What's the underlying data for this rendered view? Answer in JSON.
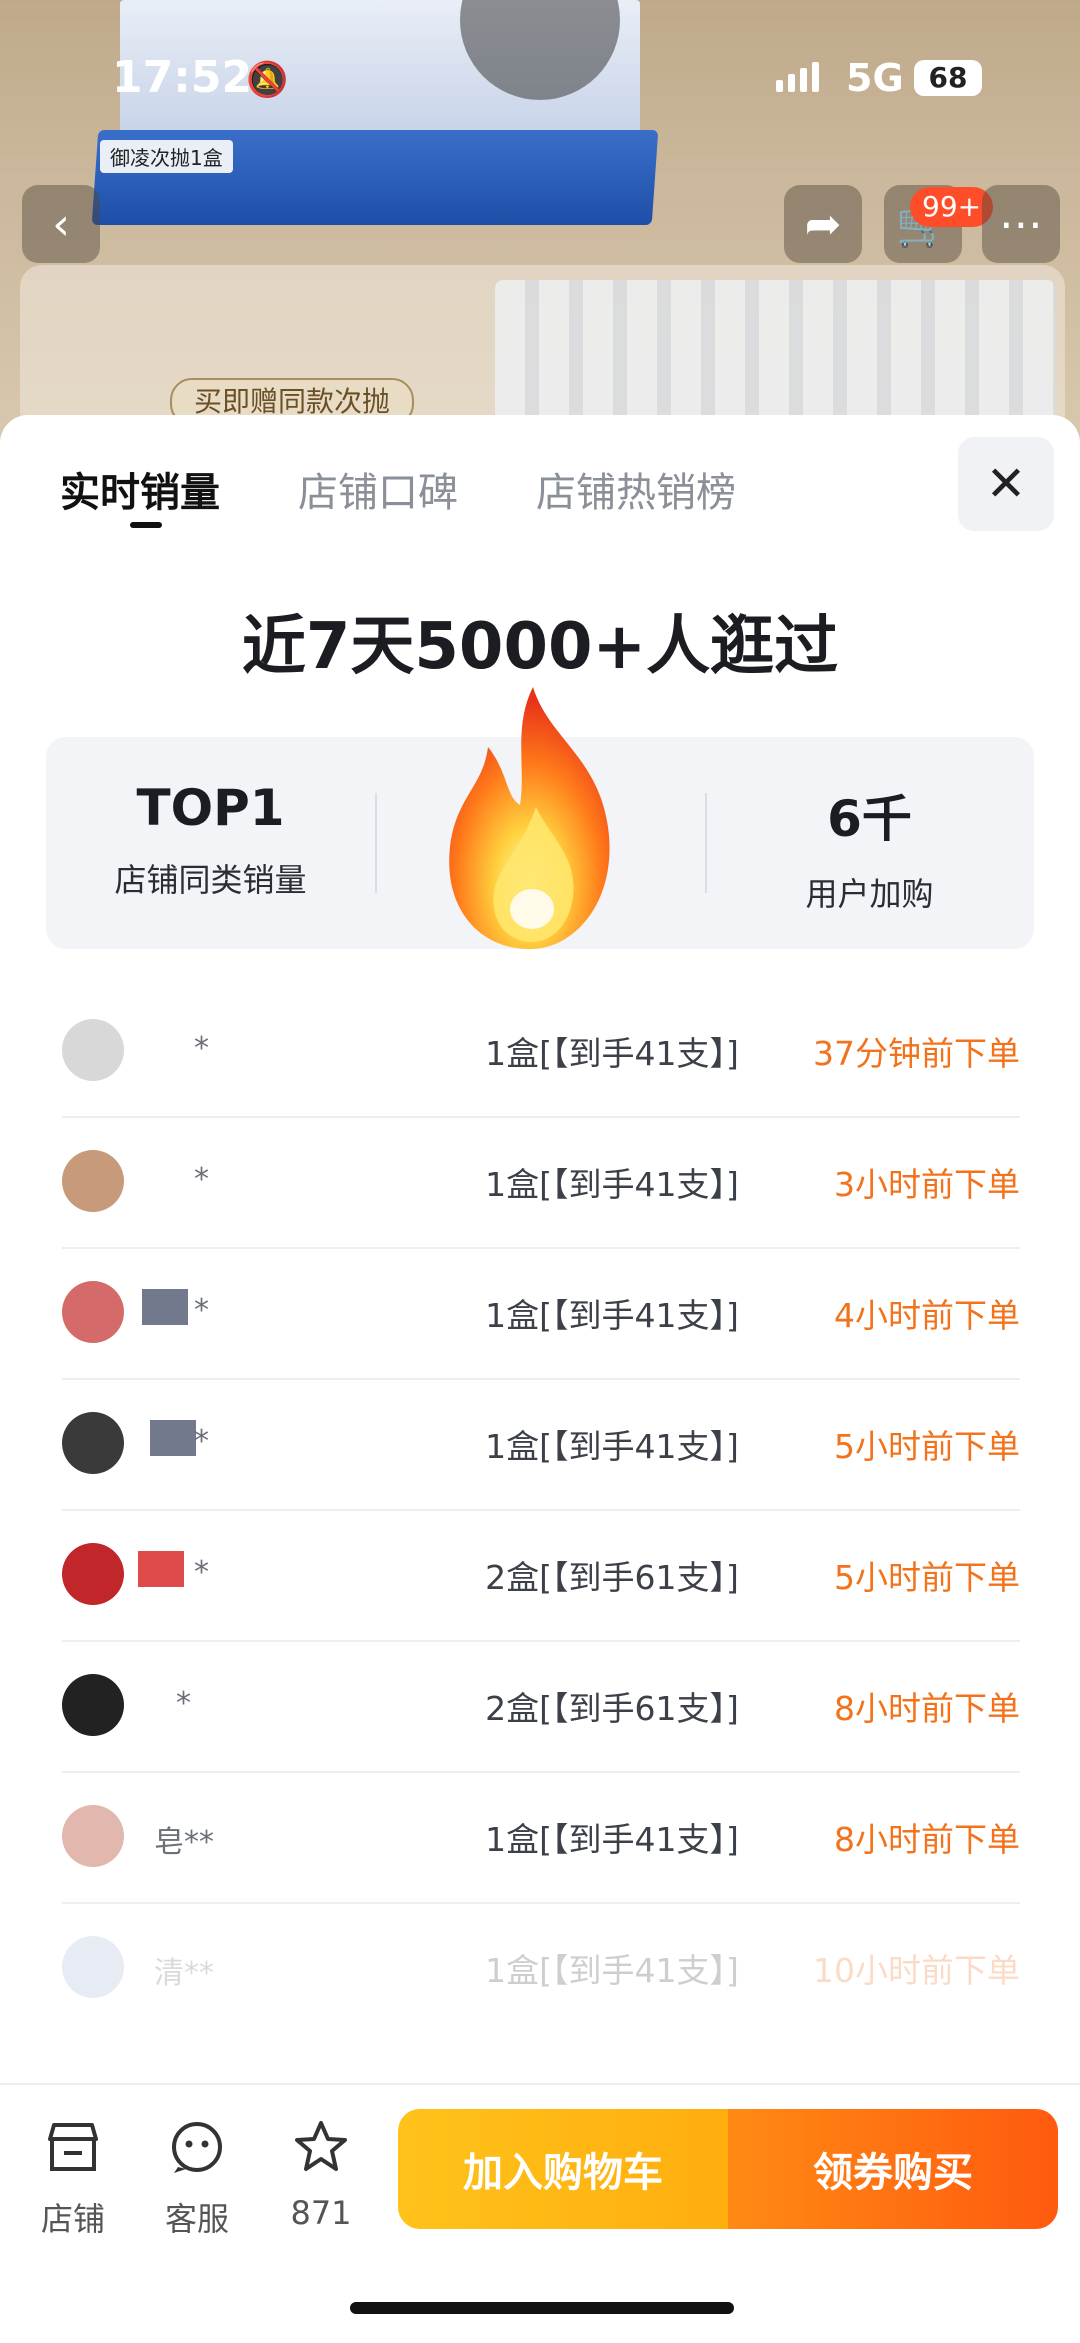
{
  "status_bar": {
    "time": "17:52",
    "network": "5G",
    "battery": "68"
  },
  "product_bg": {
    "gift_tag": "买即赠同款次抛",
    "brand_tag": "御凌次抛1盒"
  },
  "nav": {
    "cart_badge": "99+"
  },
  "tabs": [
    {
      "label": "实时销量",
      "active": true
    },
    {
      "label": "店铺口碑",
      "active": false
    },
    {
      "label": "店铺热销榜",
      "active": false
    }
  ],
  "headline": "近7天5000+人逛过",
  "stats": [
    {
      "value": "TOP1",
      "label": "店铺同类销量"
    },
    {
      "value": "",
      "label": ""
    },
    {
      "value": "6千",
      "label": "用户加购"
    }
  ],
  "orders": [
    {
      "user": "*",
      "qty": "1盒[【到手41支】]",
      "time": "37分钟前下单",
      "avatar_color": "#d8d8d8"
    },
    {
      "user": "*",
      "qty": "1盒[【到手41支】]",
      "time": "3小时前下单",
      "avatar_color": "#c79a7a"
    },
    {
      "user": "*",
      "qty": "1盒[【到手41支】]",
      "time": "4小时前下单",
      "avatar_color": "#d46a6a"
    },
    {
      "user": "*",
      "qty": "1盒[【到手41支】]",
      "time": "5小时前下单",
      "avatar_color": "#3a3a3a"
    },
    {
      "user": "*",
      "qty": "2盒[【到手61支】]",
      "time": "5小时前下单",
      "avatar_color": "#c0262a"
    },
    {
      "user": "*",
      "qty": "2盒[【到手61支】]",
      "time": "8小时前下单",
      "avatar_color": "#222222"
    },
    {
      "user": "皂**",
      "qty": "1盒[【到手41支】]",
      "time": "8小时前下单",
      "avatar_color": "#e2b7ad"
    },
    {
      "user": "清**",
      "qty": "1盒[【到手41支】]",
      "time": "10小时前下单",
      "avatar_color": "#9fb4d4"
    }
  ],
  "bottom_bar": {
    "store_label": "店铺",
    "service_label": "客服",
    "favorite_count": "871",
    "add_cart": "加入购物车",
    "buy": "领券购买"
  }
}
